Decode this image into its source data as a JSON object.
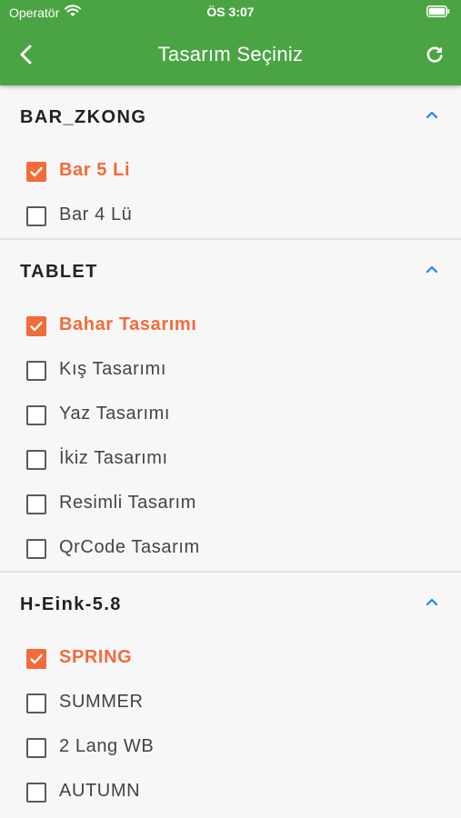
{
  "status_bar": {
    "carrier": "Operatör",
    "time": "ÖS 3:07"
  },
  "app_bar": {
    "title": "Tasarım Seçiniz",
    "background": "#4ba444"
  },
  "colors": {
    "accent": "#f26b3a",
    "chevron": "#1e88e5"
  },
  "sections": [
    {
      "title": "BAR_ZKONG",
      "expanded": true,
      "items": [
        {
          "label": "Bar 5 Li",
          "checked": true
        },
        {
          "label": "Bar 4 Lü",
          "checked": false
        }
      ]
    },
    {
      "title": "TABLET",
      "expanded": true,
      "items": [
        {
          "label": "Bahar Tasarımı",
          "checked": true
        },
        {
          "label": "Kış Tasarımı",
          "checked": false
        },
        {
          "label": "Yaz Tasarımı",
          "checked": false
        },
        {
          "label": "İkiz Tasarımı",
          "checked": false
        },
        {
          "label": "Resimli Tasarım",
          "checked": false
        },
        {
          "label": "QrCode Tasarım",
          "checked": false
        }
      ]
    },
    {
      "title": "H-Eink-5.8",
      "expanded": true,
      "items": [
        {
          "label": "SPRING",
          "checked": true
        },
        {
          "label": "SUMMER",
          "checked": false
        },
        {
          "label": "2 Lang WB",
          "checked": false
        },
        {
          "label": "AUTUMN",
          "checked": false
        }
      ]
    }
  ]
}
